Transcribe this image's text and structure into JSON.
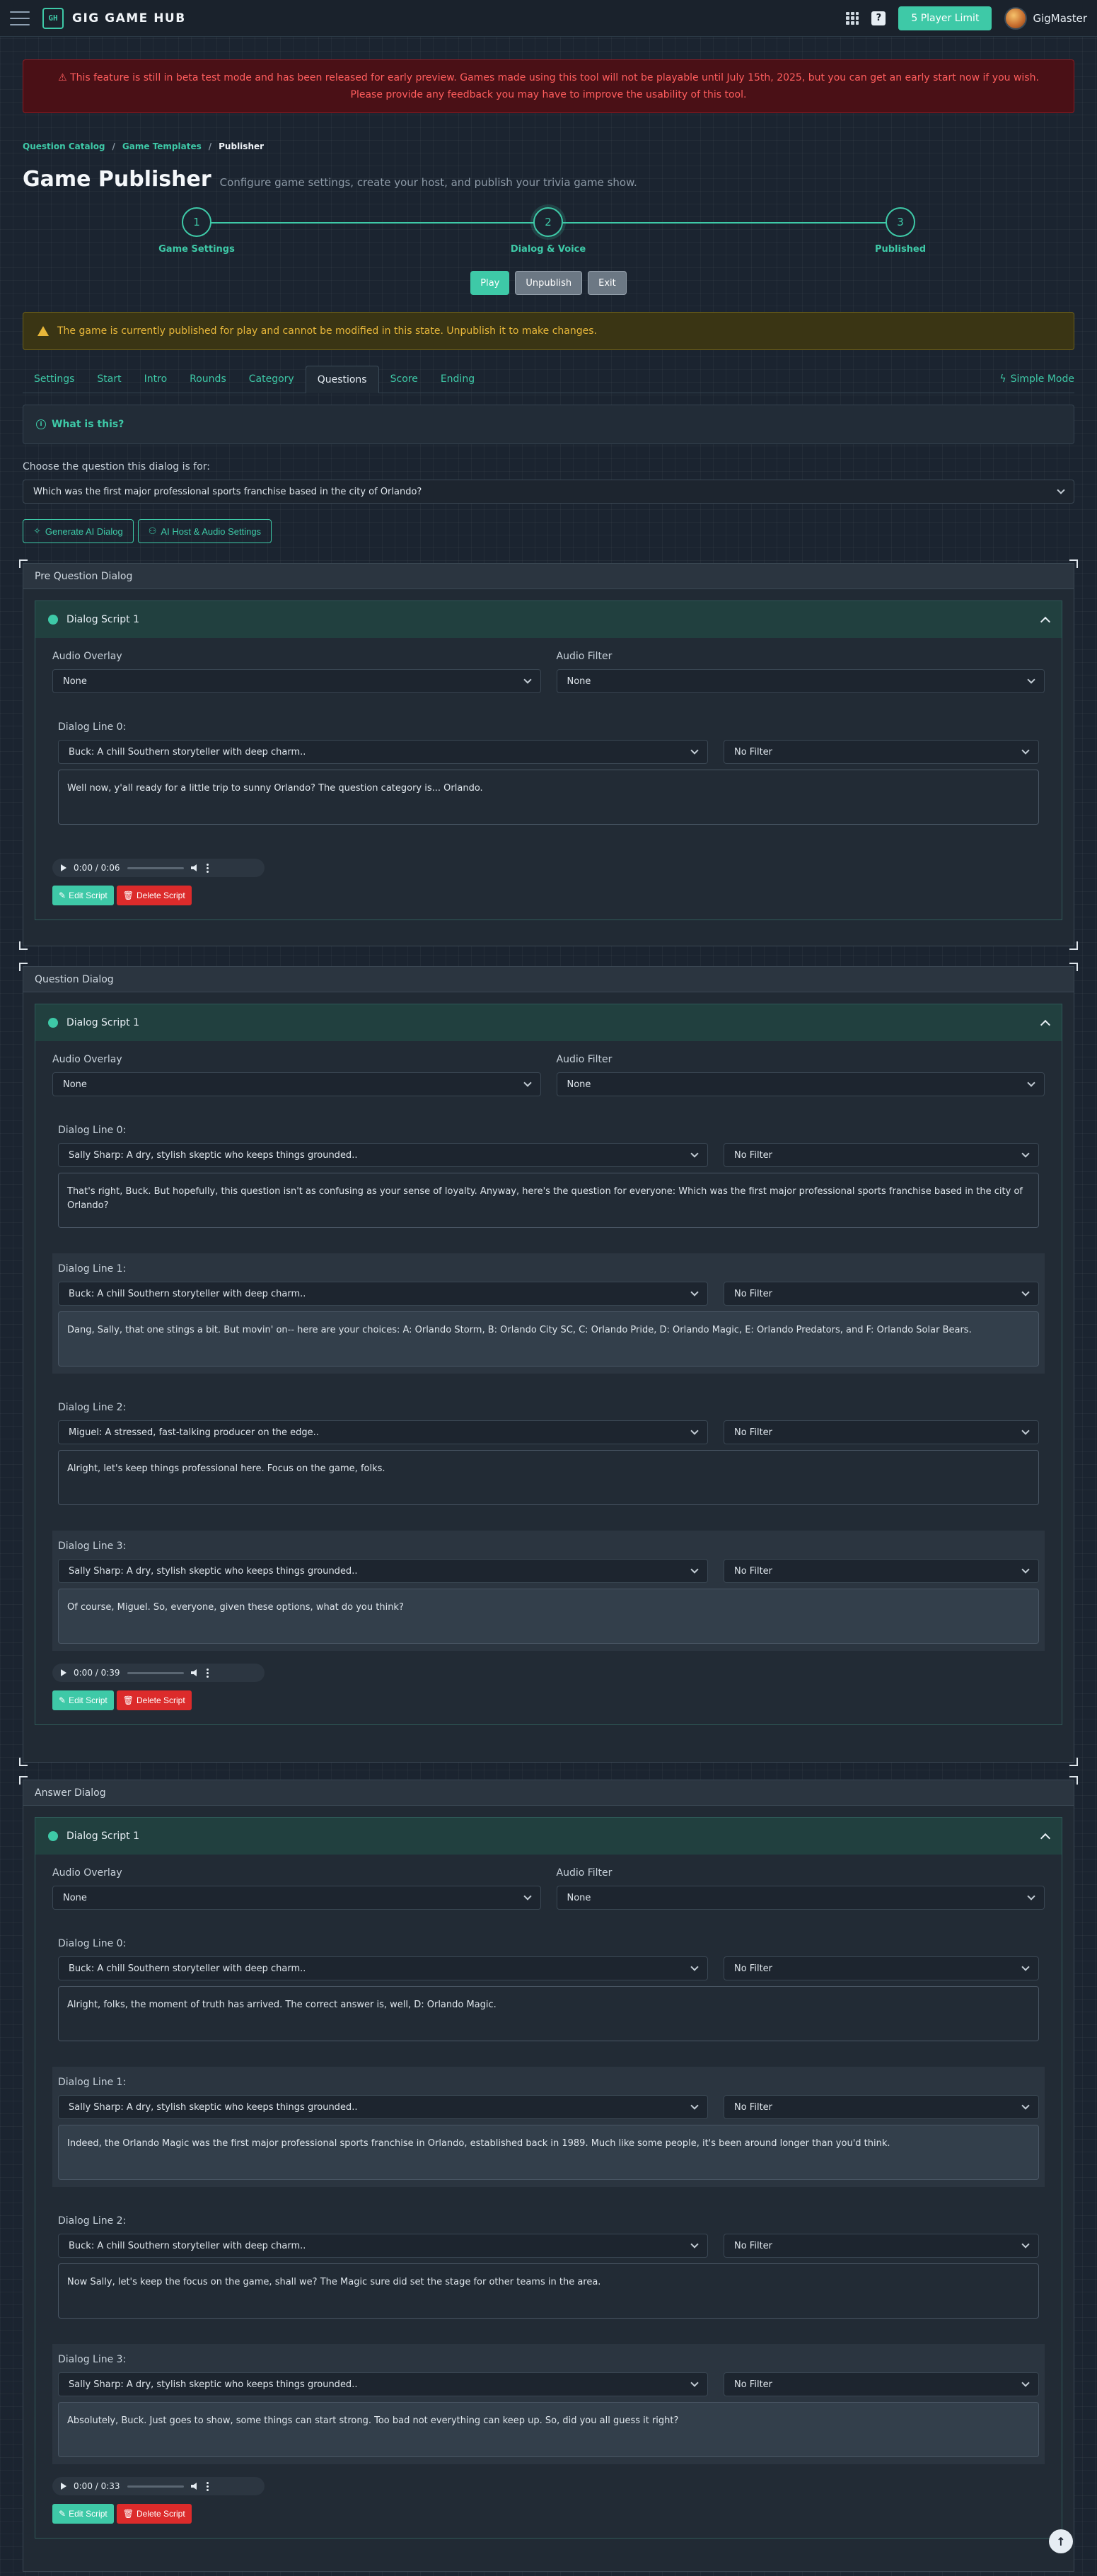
{
  "nav": {
    "brand": "GIG GAME HUB",
    "logo_glyph": "GH",
    "player_limit": "5 Player Limit",
    "help": "?",
    "username": "GigMaster",
    "icons": [
      "menu-icon",
      "grid-icon",
      "help-icon",
      "avatar"
    ]
  },
  "beta_banner": {
    "line1": "⚠ This feature is still in beta test mode and has been released for early preview. Games made using this tool will not be playable until July 15th, 2025, but you can get an early start now if you wish.",
    "line2": "Please provide any feedback you may have to improve the usability of this tool."
  },
  "breadcrumb": {
    "items": [
      "Question Catalog",
      "Game Templates",
      "Publisher"
    ],
    "separator": "/"
  },
  "header": {
    "title": "Game Publisher",
    "subtitle": "Configure game settings, create your host, and publish your trivia game show."
  },
  "stepper": {
    "steps": [
      {
        "number": "1",
        "label": "Game Settings"
      },
      {
        "number": "2",
        "label": "Dialog & Voice"
      },
      {
        "number": "3",
        "label": "Published"
      }
    ]
  },
  "actions": {
    "play": "Play",
    "unpublish": "Unpublish",
    "exit": "Exit"
  },
  "warning": "The game is currently published for play and cannot be modified in this state. Unpublish it to make changes.",
  "tabs": {
    "items": [
      "Settings",
      "Start",
      "Intro",
      "Rounds",
      "Category",
      "Questions",
      "Score",
      "Ending"
    ],
    "active": "Questions",
    "simple_mode": "Simple Mode"
  },
  "info": {
    "label": "What is this?"
  },
  "question_picker": {
    "label": "Choose the question this dialog is for:",
    "value": "Which was the first major professional sports franchise based in the city of Orlando?"
  },
  "generate": {
    "ai_dialog": "Generate AI Dialog",
    "settings": "AI Host & Audio Settings"
  },
  "common": {
    "script_title": "Dialog Script 1",
    "audio_overlay_label": "Audio Overlay",
    "audio_filter_label": "Audio Filter",
    "none": "None",
    "no_filter": "No Filter",
    "edit_script": "Edit Script",
    "delete_script": "Delete Script",
    "scroll_top": "↑"
  },
  "sections": {
    "pre": {
      "title": "Pre Question Dialog",
      "audio_time": "0:00 / 0:06",
      "audio_progress": 0,
      "lines": [
        {
          "label": "Dialog Line 0:",
          "speaker": "Buck: A chill Southern storyteller with deep charm..",
          "text": "Well now, y'all ready for a little trip to sunny Orlando? The question category is... Orlando."
        }
      ]
    },
    "question": {
      "title": "Question Dialog",
      "audio_time": "0:00 / 0:39",
      "audio_progress": 0,
      "lines": [
        {
          "label": "Dialog Line 0:",
          "speaker": "Sally Sharp: A dry, stylish skeptic who keeps things grounded..",
          "text": "That's right, Buck. But hopefully, this question isn't as confusing as your sense of loyalty. Anyway, here's the question for everyone: Which was the first major professional sports franchise based in the city of Orlando?"
        },
        {
          "label": "Dialog Line 1:",
          "speaker": "Buck: A chill Southern storyteller with deep charm..",
          "text": "Dang, Sally, that one stings a bit. But movin' on-- here are your choices: A: Orlando Storm, B: Orlando City SC, C: Orlando Pride, D: Orlando Magic, E: Orlando Predators, and F: Orlando Solar Bears."
        },
        {
          "label": "Dialog Line 2:",
          "speaker": "Miguel: A stressed, fast-talking producer on the edge..",
          "text": "Alright, let's keep things professional here. Focus on the game, folks."
        },
        {
          "label": "Dialog Line 3:",
          "speaker": "Sally Sharp: A dry, stylish skeptic who keeps things grounded..",
          "text": "Of course, Miguel. So, everyone, given these options, what do you think?"
        }
      ]
    },
    "answer": {
      "title": "Answer Dialog",
      "audio_time": "0:00 / 0:33",
      "audio_progress": 0,
      "lines": [
        {
          "label": "Dialog Line 0:",
          "speaker": "Buck: A chill Southern storyteller with deep charm..",
          "text": "Alright, folks, the moment of truth has arrived. The correct answer is, well, D: Orlando Magic."
        },
        {
          "label": "Dialog Line 1:",
          "speaker": "Sally Sharp: A dry, stylish skeptic who keeps things grounded..",
          "text": "Indeed, the Orlando Magic was the first major professional sports franchise in Orlando, established back in 1989. Much like some people, it's been around longer than you'd think."
        },
        {
          "label": "Dialog Line 2:",
          "speaker": "Buck: A chill Southern storyteller with deep charm..",
          "text": "Now Sally, let's keep the focus on the game, shall we? The Magic sure did set the stage for other teams in the area."
        },
        {
          "label": "Dialog Line 3:",
          "speaker": "Sally Sharp: A dry, stylish skeptic who keeps things grounded..",
          "text": "Absolutely, Buck. Just goes to show, some things can start strong. Too bad not everything can keep up. So, did you all guess it right?"
        }
      ]
    }
  },
  "colors": {
    "accent": "#3ec9a7",
    "danger": "#dc2b2b",
    "warning": "#e8b73a",
    "background": "#1b2430"
  }
}
